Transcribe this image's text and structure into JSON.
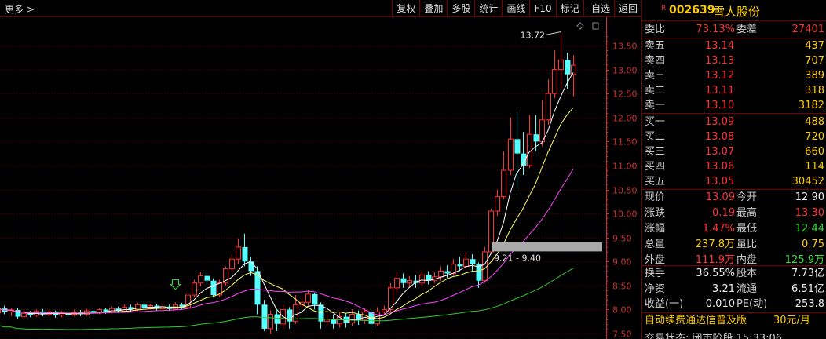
{
  "toolbar": {
    "more": "更多 >",
    "buttons": [
      "复权",
      "叠加",
      "多股",
      "统计",
      "画线",
      "F10",
      "标记",
      "-自选",
      "返回"
    ]
  },
  "stock": {
    "r_badge": "R",
    "code": "002639",
    "name": "雪人股份"
  },
  "order_book": {
    "weibi_label": "委比",
    "weibi_value": "73.13%",
    "weicha_label": "委差",
    "weicha_value": "27401",
    "asks": [
      {
        "label": "卖五",
        "price": "13.14",
        "vol": "437"
      },
      {
        "label": "卖四",
        "price": "13.13",
        "vol": "707"
      },
      {
        "label": "卖三",
        "price": "13.12",
        "vol": "389"
      },
      {
        "label": "卖二",
        "price": "13.11",
        "vol": "318"
      },
      {
        "label": "卖一",
        "price": "13.10",
        "vol": "3182"
      }
    ],
    "bids": [
      {
        "label": "买一",
        "price": "13.09",
        "vol": "488"
      },
      {
        "label": "买二",
        "price": "13.08",
        "vol": "720"
      },
      {
        "label": "买三",
        "price": "13.07",
        "vol": "660"
      },
      {
        "label": "买四",
        "price": "13.06",
        "vol": "114"
      },
      {
        "label": "买五",
        "price": "13.05",
        "vol": "30452"
      }
    ]
  },
  "quote": {
    "xianjia_label": "现价",
    "xianjia": "13.09",
    "jinkai_label": "今开",
    "jinkai": "12.90",
    "zhangdie_label": "涨跌",
    "zhangdie": "0.19",
    "zuigao_label": "最高",
    "zuigao": "13.30",
    "zhangfu_label": "涨幅",
    "zhangfu": "1.47%",
    "zuidi_label": "最低",
    "zuidi": "12.44",
    "zongliang_label": "总量",
    "zongliang": "237.8万",
    "liangbi_label": "量比",
    "liangbi": "0.75",
    "waipan_label": "外盘",
    "waipan": "111.9万",
    "neipan_label": "内盘",
    "neipan": "125.9万",
    "huanshou_label": "换手",
    "huanshou": "36.55%",
    "guben_label": "股本",
    "guben": "7.73亿",
    "jingzi_label": "净资",
    "jingzi": "3.21",
    "liutong_label": "流通",
    "liutong": "6.51亿",
    "shouyi_label": "收益(一)",
    "shouyi": "0.010",
    "pe_label": "PE(动)",
    "pe": "253.8"
  },
  "ad": {
    "text": "自动续费通达信普及版",
    "price": "30元/月"
  },
  "status": {
    "text": "交易状态: 闭市阶段 15:33:06"
  },
  "chart": {
    "high_marker": "13.72",
    "range_label": "9.21 - 9.40",
    "price_ticks": [
      "13.50",
      "13.00",
      "12.50",
      "12.00",
      "11.50",
      "11.00",
      "10.50",
      "10.00",
      "9.50",
      "9.00",
      "8.50",
      "8.00",
      "7.50"
    ],
    "colors": {
      "up": "#ff3333",
      "down": "#54ffff",
      "ma5": "#ffffff",
      "ma10": "#ffff66",
      "ma20": "#ff44ff",
      "ma60": "#33cc33",
      "grid": "#5a0000"
    }
  },
  "chart_data": {
    "type": "candlestick",
    "y_ticks": [
      13.5,
      13.0,
      12.5,
      12.0,
      11.5,
      11.0,
      10.5,
      10.0,
      9.5,
      9.0,
      8.5,
      8.0,
      7.5
    ],
    "ylim": [
      7.45,
      13.9
    ],
    "candles": [
      [
        7.93,
        8.02,
        8.06,
        7.88
      ],
      [
        8.02,
        7.95,
        8.08,
        7.9
      ],
      [
        7.95,
        7.99,
        8.04,
        7.86
      ],
      [
        7.99,
        7.85,
        8.03,
        7.8
      ],
      [
        7.85,
        7.92,
        7.98,
        7.82
      ],
      [
        7.92,
        7.88,
        7.97,
        7.84
      ],
      [
        7.88,
        7.96,
        8.0,
        7.85
      ],
      [
        7.96,
        7.9,
        8.01,
        7.86
      ],
      [
        7.9,
        7.95,
        7.99,
        7.86
      ],
      [
        7.95,
        7.88,
        7.98,
        7.83
      ],
      [
        7.88,
        7.93,
        7.97,
        7.84
      ],
      [
        7.93,
        7.89,
        7.97,
        7.84
      ],
      [
        7.89,
        7.94,
        7.99,
        7.86
      ],
      [
        7.94,
        7.9,
        7.99,
        7.86
      ],
      [
        7.9,
        7.97,
        8.01,
        7.87
      ],
      [
        7.97,
        7.93,
        8.01,
        7.89
      ],
      [
        7.93,
        8.0,
        8.04,
        7.9
      ],
      [
        8.0,
        7.95,
        8.04,
        7.91
      ],
      [
        7.95,
        8.02,
        8.06,
        7.92
      ],
      [
        8.02,
        7.97,
        8.06,
        7.93
      ],
      [
        7.97,
        8.05,
        8.1,
        7.94
      ],
      [
        8.05,
        8.0,
        8.1,
        7.96
      ],
      [
        8.0,
        8.1,
        8.14,
        7.97
      ],
      [
        8.1,
        8.03,
        8.14,
        7.99
      ],
      [
        8.03,
        8.08,
        8.12,
        8.0
      ],
      [
        8.08,
        8.02,
        8.12,
        7.98
      ],
      [
        8.02,
        8.06,
        8.1,
        7.99
      ],
      [
        8.06,
        8.01,
        8.1,
        7.97
      ],
      [
        8.01,
        8.1,
        8.15,
        7.98
      ],
      [
        8.1,
        8.04,
        8.14,
        8.0
      ],
      [
        8.04,
        8.3,
        8.35,
        8.02
      ],
      [
        8.3,
        8.55,
        8.62,
        8.25
      ],
      [
        8.55,
        8.7,
        8.78,
        8.48
      ],
      [
        8.7,
        8.6,
        8.78,
        8.52
      ],
      [
        8.6,
        8.3,
        8.65,
        8.25
      ],
      [
        8.3,
        8.55,
        8.62,
        8.25
      ],
      [
        8.55,
        8.85,
        8.9,
        8.5
      ],
      [
        8.85,
        9.05,
        9.15,
        8.78
      ],
      [
        9.05,
        9.3,
        9.48,
        8.95
      ],
      [
        9.3,
        9.0,
        9.58,
        8.9
      ],
      [
        9.0,
        8.8,
        9.1,
        8.7
      ],
      [
        8.8,
        8.1,
        8.9,
        7.9
      ],
      [
        8.1,
        7.6,
        8.2,
        7.55
      ],
      [
        7.6,
        7.9,
        7.98,
        7.5
      ],
      [
        7.9,
        7.7,
        7.98,
        7.55
      ],
      [
        7.7,
        8.0,
        8.1,
        7.6
      ],
      [
        8.0,
        7.75,
        8.05,
        7.6
      ],
      [
        7.75,
        8.1,
        8.3,
        7.7
      ],
      [
        8.1,
        8.15,
        8.3,
        8.02
      ],
      [
        8.15,
        8.32,
        8.4,
        8.08
      ],
      [
        8.32,
        8.1,
        8.35,
        8.0
      ],
      [
        8.1,
        7.75,
        8.15,
        7.6
      ],
      [
        7.75,
        7.8,
        7.9,
        7.65
      ],
      [
        7.8,
        7.7,
        7.9,
        7.6
      ],
      [
        7.7,
        7.85,
        7.95,
        7.62
      ],
      [
        7.85,
        7.72,
        7.92,
        7.62
      ],
      [
        7.72,
        7.9,
        8.0,
        7.65
      ],
      [
        7.9,
        7.78,
        7.98,
        7.68
      ],
      [
        7.78,
        7.95,
        8.02,
        7.7
      ],
      [
        7.95,
        7.7,
        8.0,
        7.6
      ],
      [
        7.7,
        7.95,
        8.05,
        7.65
      ],
      [
        7.95,
        8.0,
        8.08,
        7.88
      ],
      [
        8.0,
        8.45,
        8.55,
        7.95
      ],
      [
        8.45,
        8.65,
        8.78,
        8.35
      ],
      [
        8.65,
        8.55,
        8.75,
        8.45
      ],
      [
        8.55,
        8.6,
        8.7,
        8.45
      ],
      [
        8.6,
        8.55,
        8.72,
        8.45
      ],
      [
        8.55,
        8.72,
        8.8,
        8.5
      ],
      [
        8.72,
        8.6,
        8.8,
        8.52
      ],
      [
        8.6,
        8.68,
        8.78,
        8.55
      ],
      [
        8.68,
        8.8,
        8.9,
        8.6
      ],
      [
        8.8,
        8.75,
        8.92,
        8.65
      ],
      [
        8.75,
        8.95,
        9.05,
        8.7
      ],
      [
        8.95,
        8.9,
        9.1,
        8.8
      ],
      [
        8.9,
        9.05,
        9.2,
        8.85
      ],
      [
        9.05,
        8.95,
        9.15,
        8.8
      ],
      [
        8.95,
        8.6,
        8.98,
        8.45
      ],
      [
        8.6,
        9.2,
        9.3,
        8.55
      ],
      [
        9.2,
        10.05,
        10.1,
        9.15
      ],
      [
        10.05,
        10.35,
        10.5,
        9.95
      ],
      [
        10.35,
        10.9,
        11.3,
        10.3
      ],
      [
        10.9,
        11.55,
        12.0,
        10.8
      ],
      [
        11.55,
        11.25,
        12.1,
        10.5
      ],
      [
        11.25,
        11.0,
        11.7,
        10.8
      ],
      [
        11.0,
        11.65,
        12.05,
        10.95
      ],
      [
        11.65,
        11.5,
        12.05,
        11.3
      ],
      [
        11.5,
        11.95,
        12.35,
        11.4
      ],
      [
        11.95,
        12.5,
        12.8,
        11.85
      ],
      [
        12.5,
        13.0,
        13.4,
        12.4
      ],
      [
        13.0,
        13.2,
        13.72,
        12.6
      ],
      [
        13.2,
        12.9,
        13.35,
        12.6
      ],
      [
        12.9,
        13.09,
        13.3,
        12.44
      ]
    ]
  }
}
